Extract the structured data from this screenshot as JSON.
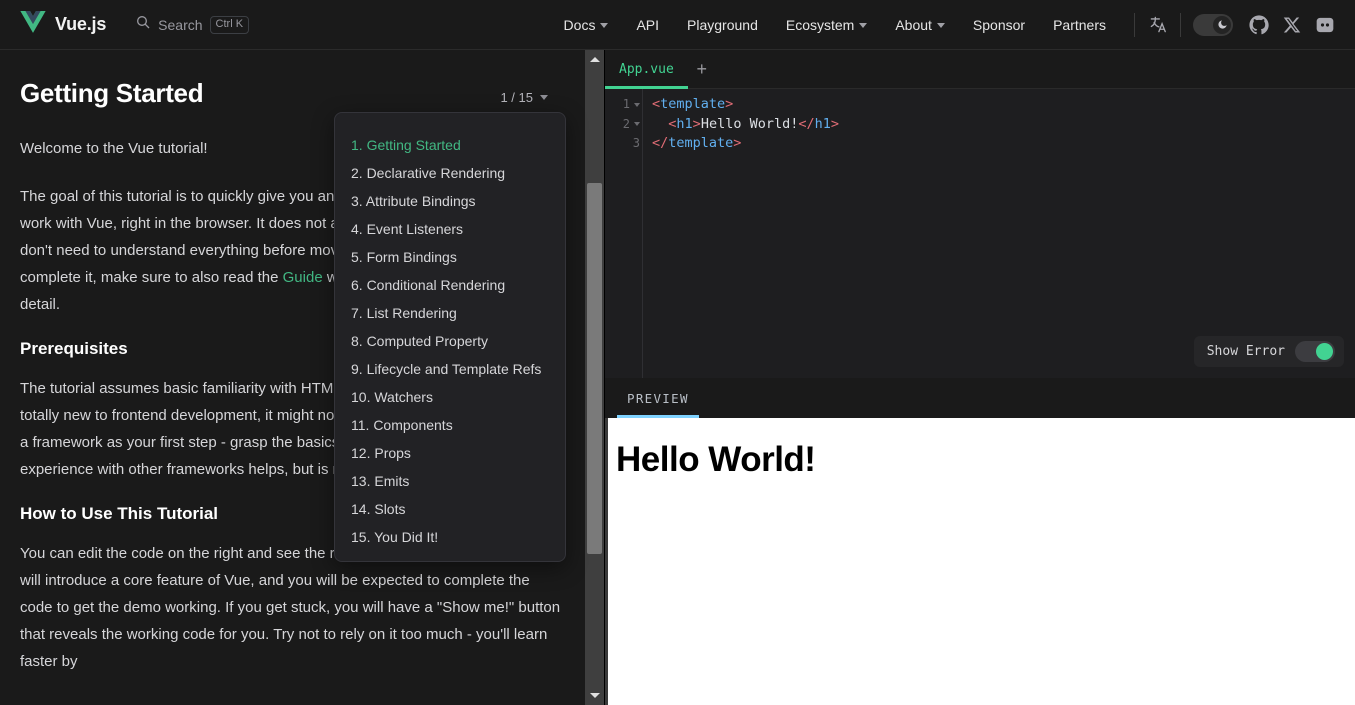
{
  "navbar": {
    "brand": {
      "name": "Vue.js",
      "logo_icon": "vue-logo-icon"
    },
    "search": {
      "label": "Search",
      "shortcut": "Ctrl K",
      "icon": "search-icon"
    },
    "links": [
      {
        "label": "Docs",
        "has_chevron": true
      },
      {
        "label": "API",
        "has_chevron": false
      },
      {
        "label": "Playground",
        "has_chevron": false
      },
      {
        "label": "Ecosystem",
        "has_chevron": true
      },
      {
        "label": "About",
        "has_chevron": true
      },
      {
        "label": "Sponsor",
        "has_chevron": false
      },
      {
        "label": "Partners",
        "has_chevron": false
      }
    ],
    "translate_icon": "translate-language-icon",
    "appearance_toggle": {
      "icon": "moon-icon",
      "state": "dark"
    },
    "social": [
      {
        "name": "github-icon"
      },
      {
        "name": "x-twitter-icon"
      },
      {
        "name": "discord-icon"
      }
    ]
  },
  "tutorial": {
    "title": "Getting Started",
    "step_indicator": "1 / 15",
    "paragraphs": [
      "Welcome to the Vue tutorial!",
      "The goal of this tutorial is to quickly give you an experience of what it feels like to work with Vue, right in the browser. It does not aim to be comprehensive, and you don't need to understand everything before moving on. However, after you complete it, make sure to also read the Guide which covers each topic in more detail."
    ],
    "link_text": "Guide",
    "sections": [
      {
        "heading": "Prerequisites",
        "body": "The tutorial assumes basic familiarity with HTML, CSS and JavaScript. If you are totally new to frontend development, it might not be the best idea to jump right into a framework as your first step - grasp the basics then come back! Prior experience with other frameworks helps, but is not required."
      },
      {
        "heading": "How to Use This Tutorial",
        "body": "You can edit the code on the right and see the result update instantly. Each step will introduce a core feature of Vue, and you will be expected to complete the code to get the demo working. If you get stuck, you will have a \"Show me!\" button that reveals the working code for you. Try not to rely on it too much - you'll learn faster by"
      }
    ]
  },
  "step_dropdown": {
    "items": [
      {
        "label": "1. Getting Started",
        "active": true
      },
      {
        "label": "2. Declarative Rendering",
        "active": false
      },
      {
        "label": "3. Attribute Bindings",
        "active": false
      },
      {
        "label": "4. Event Listeners",
        "active": false
      },
      {
        "label": "5. Form Bindings",
        "active": false
      },
      {
        "label": "6. Conditional Rendering",
        "active": false
      },
      {
        "label": "7. List Rendering",
        "active": false
      },
      {
        "label": "8. Computed Property",
        "active": false
      },
      {
        "label": "9. Lifecycle and Template Refs",
        "active": false
      },
      {
        "label": "10. Watchers",
        "active": false
      },
      {
        "label": "11. Components",
        "active": false
      },
      {
        "label": "12. Props",
        "active": false
      },
      {
        "label": "13. Emits",
        "active": false
      },
      {
        "label": "14. Slots",
        "active": false
      },
      {
        "label": "15. You Did It!",
        "active": false
      }
    ]
  },
  "editor": {
    "tabs": [
      {
        "label": "App.vue",
        "active": true
      }
    ],
    "add_tab_label": "+",
    "lines": [
      {
        "number": "1",
        "foldable": true,
        "tokens": [
          {
            "t": "punct",
            "v": "<"
          },
          {
            "t": "tag",
            "v": "template"
          },
          {
            "t": "punct",
            "v": ">"
          }
        ]
      },
      {
        "number": "2",
        "foldable": true,
        "tokens": [
          {
            "t": "text",
            "v": "  "
          },
          {
            "t": "punct",
            "v": "<"
          },
          {
            "t": "tag",
            "v": "h1"
          },
          {
            "t": "punct",
            "v": ">"
          },
          {
            "t": "text",
            "v": "Hello World!"
          },
          {
            "t": "punct",
            "v": "</"
          },
          {
            "t": "tag",
            "v": "h1"
          },
          {
            "t": "punct",
            "v": ">"
          }
        ]
      },
      {
        "number": "3",
        "foldable": false,
        "tokens": [
          {
            "t": "punct",
            "v": "</"
          },
          {
            "t": "tag",
            "v": "template"
          },
          {
            "t": "punct",
            "v": ">"
          }
        ]
      }
    ],
    "show_error": {
      "label": "Show Error",
      "enabled": true
    }
  },
  "preview": {
    "tab_label": "PREVIEW",
    "heading": "Hello World!"
  },
  "colors": {
    "brand_green": "#42b883",
    "editor_green": "#42d392",
    "preview_underline": "#7fd2ff",
    "tag_blue": "#61afef",
    "punct_red": "#e06c75",
    "bg_dark": "#1a1a1a"
  }
}
